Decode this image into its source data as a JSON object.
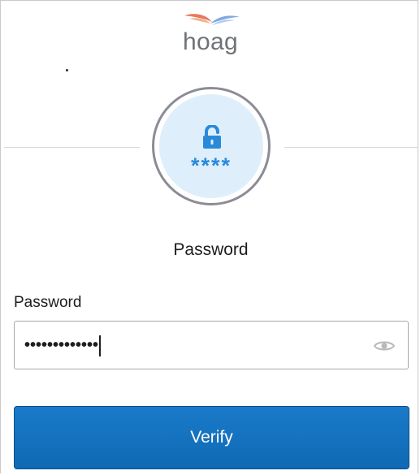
{
  "brand": {
    "logo_text": "hoag",
    "logo_icon": "hoag-wing-logo",
    "logo_text_color": "#6f7378",
    "wing_colors": [
      "#e9775e",
      "#f4b089",
      "#7fa8e2",
      "#b6cdee"
    ]
  },
  "factor": {
    "icon": "unlocked-padlock-icon",
    "masked_text": "****",
    "accent_color": "#2a8ad8",
    "beacon_color": "#deeffb"
  },
  "form": {
    "heading": "Password",
    "password_label": "Password",
    "password_value": "•••••••••••••",
    "reveal_icon": "eye-icon",
    "submit_label": "Verify",
    "submit_color": "#1575c2"
  }
}
